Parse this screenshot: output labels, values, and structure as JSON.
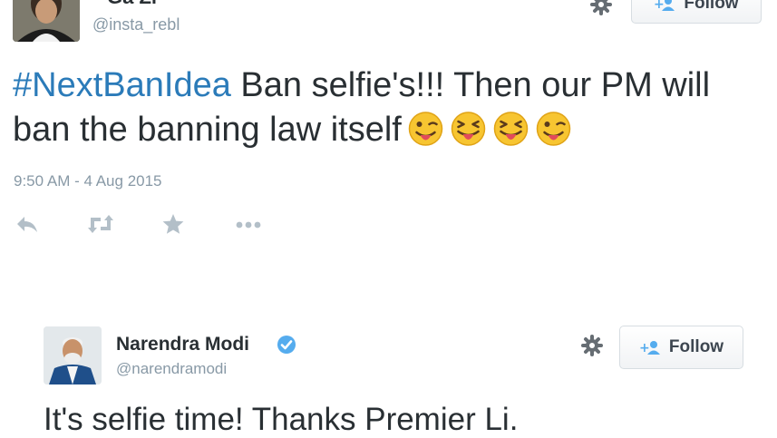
{
  "tweet1": {
    "name": "Ga Zi",
    "handle": "@insta_rebl",
    "follow_label": "Follow",
    "text_hashtag": "#NextBanIdea",
    "text_body": " Ban selfie's!!! Then our PM will ban the banning law itself",
    "emojis": [
      "winking-tongue-emoji",
      "squinting-tongue-emoji",
      "squinting-tongue-emoji",
      "winking-tongue-emoji"
    ],
    "timestamp": "9:50 AM - 4 Aug 2015",
    "actions": [
      "reply-icon",
      "retweet-icon",
      "favorite-icon",
      "more-icon"
    ]
  },
  "tweet2": {
    "name": "Narendra Modi",
    "handle": "@narendramodi",
    "verified": true,
    "follow_label": "Follow",
    "text": "It's selfie time! Thanks Premier Li."
  },
  "colors": {
    "link": "#2b7bb9",
    "muted": "#8899a6",
    "text": "#292f33",
    "verified": "#55acee"
  }
}
